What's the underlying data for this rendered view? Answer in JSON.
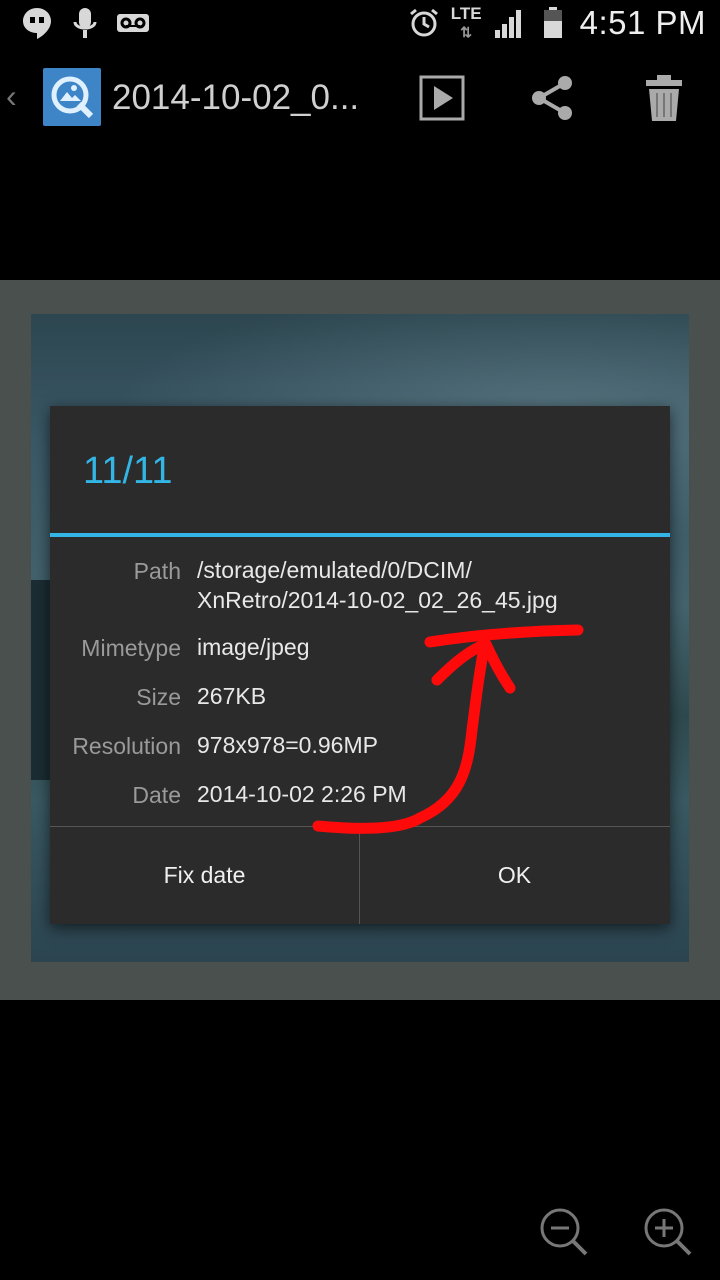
{
  "status_bar": {
    "clock": "4:51 PM",
    "network": "LTE",
    "left_icons": [
      "hangouts-icon",
      "voice-icon",
      "voicemail-icon"
    ],
    "right_icons": [
      "alarm-icon",
      "signal-icon",
      "battery-icon"
    ]
  },
  "action_bar": {
    "title": "2014-10-02_0...",
    "buttons": [
      "play-icon",
      "share-icon",
      "delete-icon"
    ]
  },
  "dialog": {
    "title": "11/11",
    "rows": [
      {
        "label": "Path",
        "value_line1": "/storage/emulated/0/DCIM/",
        "value_line2": "XnRetro/2014-10-02_02_26_45.jpg"
      },
      {
        "label": "Mimetype",
        "value": "image/jpeg"
      },
      {
        "label": "Size",
        "value": "267KB"
      },
      {
        "label": "Resolution",
        "value": "978x978=0.96MP"
      },
      {
        "label": "Date",
        "value": "2014-10-02 2:26 PM"
      }
    ],
    "buttons": {
      "fix_date": "Fix date",
      "ok": "OK"
    }
  },
  "colors": {
    "accent": "#33b5e5",
    "annotation": "#ff0000",
    "dialog_bg": "#2b2b2b"
  }
}
